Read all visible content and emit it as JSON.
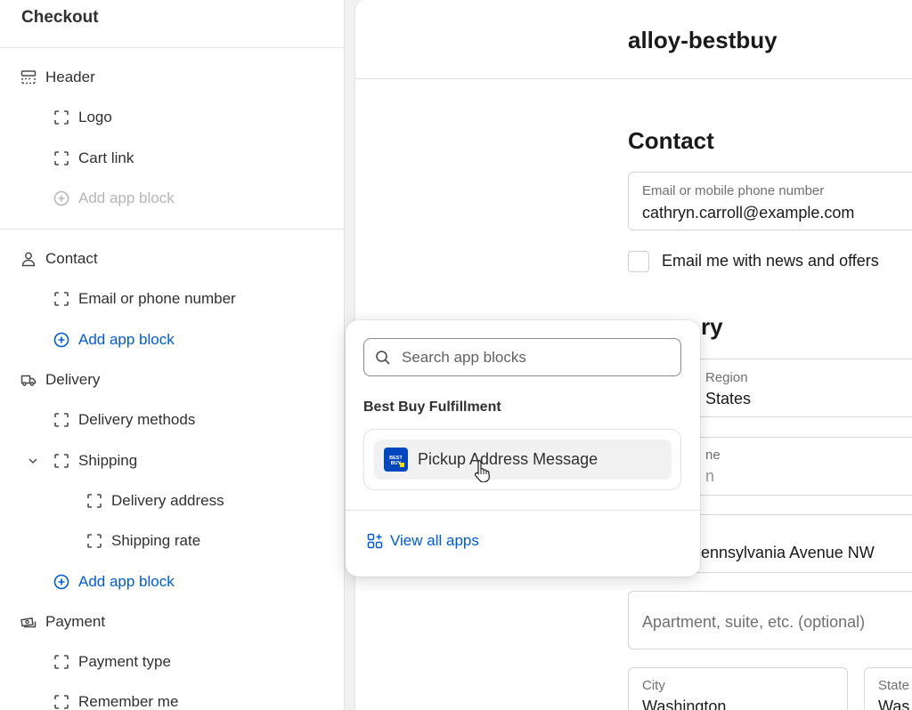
{
  "sidebar": {
    "title": "Checkout",
    "sections": {
      "header": {
        "label": "Header",
        "logo": "Logo",
        "cart_link": "Cart link",
        "add_app_block": "Add app block"
      },
      "contact": {
        "label": "Contact",
        "email_or_phone": "Email or phone number",
        "add_app_block": "Add app block"
      },
      "delivery": {
        "label": "Delivery",
        "delivery_methods": "Delivery methods",
        "shipping": "Shipping",
        "delivery_address": "Delivery address",
        "shipping_rate": "Shipping rate",
        "add_app_block": "Add app block"
      },
      "payment": {
        "label": "Payment",
        "payment_type": "Payment type",
        "remember_me": "Remember me"
      }
    }
  },
  "preview": {
    "shop_name": "alloy-bestbuy",
    "contact": {
      "title": "Contact",
      "email_label": "Email or mobile phone number",
      "email_value": "cathryn.carroll@example.com",
      "news_label": "Email me with news and offers"
    },
    "delivery": {
      "title_partial": "ry",
      "country_label_partial": "Region",
      "country_value_partial": "States",
      "name_label_partial": "ne",
      "name_value_partial": "n",
      "address_value_partial": "ennsylvania Avenue NW",
      "apartment_placeholder": "Apartment, suite, etc. (optional)",
      "city_label": "City",
      "city_value": "Washington",
      "state_label": "State",
      "state_value": "Was"
    }
  },
  "popover": {
    "search_placeholder": "Search app blocks",
    "group_heading": "Best Buy Fulfillment",
    "item_label": "Pickup Address Message",
    "view_all": "View all apps",
    "logo_text": "BEST BUY"
  },
  "colors": {
    "accent_blue": "#005bd3",
    "bestbuy_blue": "#0046be",
    "bestbuy_yellow": "#ffe000"
  }
}
